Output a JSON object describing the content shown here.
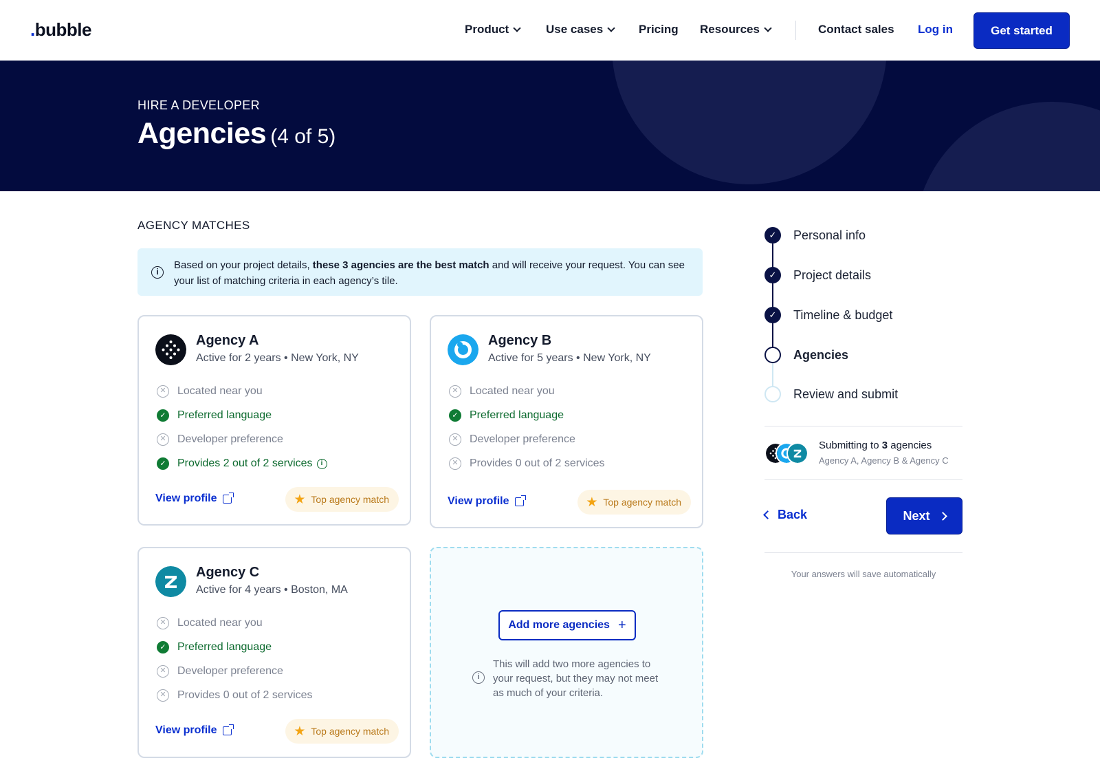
{
  "nav": {
    "logo_dot": ".",
    "logo_text": "bubble",
    "items": [
      {
        "label": "Product"
      },
      {
        "label": "Use cases"
      },
      {
        "label": "Pricing"
      },
      {
        "label": "Resources"
      }
    ],
    "contact_sales": "Contact sales",
    "login": "Log in",
    "get_started": "Get started"
  },
  "hero": {
    "eyebrow": "HIRE A DEVELOPER",
    "title": "Agencies",
    "step_count": "(4 of 5)"
  },
  "section": {
    "label": "AGENCY MATCHES",
    "banner_pre": "Based on your project details, ",
    "banner_bold": "these 3 agencies are the best match",
    "banner_post": " and will receive your request. You can see your list of matching criteria in each agency’s tile."
  },
  "agencies": [
    {
      "name": "Agency A",
      "active": "Active for 2 years",
      "location": "New York, NY",
      "color": "#0b0f1a",
      "criteria": [
        {
          "label": "Located near you",
          "met": false
        },
        {
          "label": "Preferred language",
          "met": true
        },
        {
          "label": "Developer preference",
          "met": false
        },
        {
          "label": "Provides 2 out of 2 services",
          "met": true
        }
      ],
      "view_profile": "View profile",
      "badge": "Top agency match"
    },
    {
      "name": "Agency B",
      "active": "Active for 5 years",
      "location": "New York, NY",
      "color": "#1aa7ee",
      "criteria": [
        {
          "label": "Located near you",
          "met": false
        },
        {
          "label": "Preferred language",
          "met": true
        },
        {
          "label": "Developer preference",
          "met": false
        },
        {
          "label": "Provides 0 out of 2 services",
          "met": false
        }
      ],
      "view_profile": "View profile",
      "badge": "Top agency match"
    },
    {
      "name": "Agency C",
      "active": "Active for 4 years",
      "location": "Boston, MA",
      "color": "#0f8aa3",
      "criteria": [
        {
          "label": "Located near you",
          "met": false
        },
        {
          "label": "Preferred language",
          "met": true
        },
        {
          "label": "Developer preference",
          "met": false
        },
        {
          "label": "Provides 0 out of 2 services",
          "met": false
        }
      ],
      "view_profile": "View profile",
      "badge": "Top agency match"
    }
  ],
  "add_more": {
    "button": "Add more agencies",
    "note": "This will add two more agencies to your request, but they may not meet as much of your criteria."
  },
  "stepper": [
    {
      "label": "Personal info",
      "state": "done"
    },
    {
      "label": "Project details",
      "state": "done"
    },
    {
      "label": "Timeline & budget",
      "state": "done"
    },
    {
      "label": "Agencies",
      "state": "current"
    },
    {
      "label": "Review and submit",
      "state": "todo"
    }
  ],
  "submitting": {
    "prefix": "Submitting to ",
    "count": "3",
    "suffix": " agencies",
    "list": "Agency A, Agency B & Agency C"
  },
  "actions": {
    "back": "Back",
    "next": "Next",
    "autosave": "Your answers will save automatically"
  },
  "colors": {
    "primary": "#0a2bc2",
    "hero_bg": "#030b3e",
    "success": "#0f7b34",
    "badge_text": "#b9791a"
  }
}
